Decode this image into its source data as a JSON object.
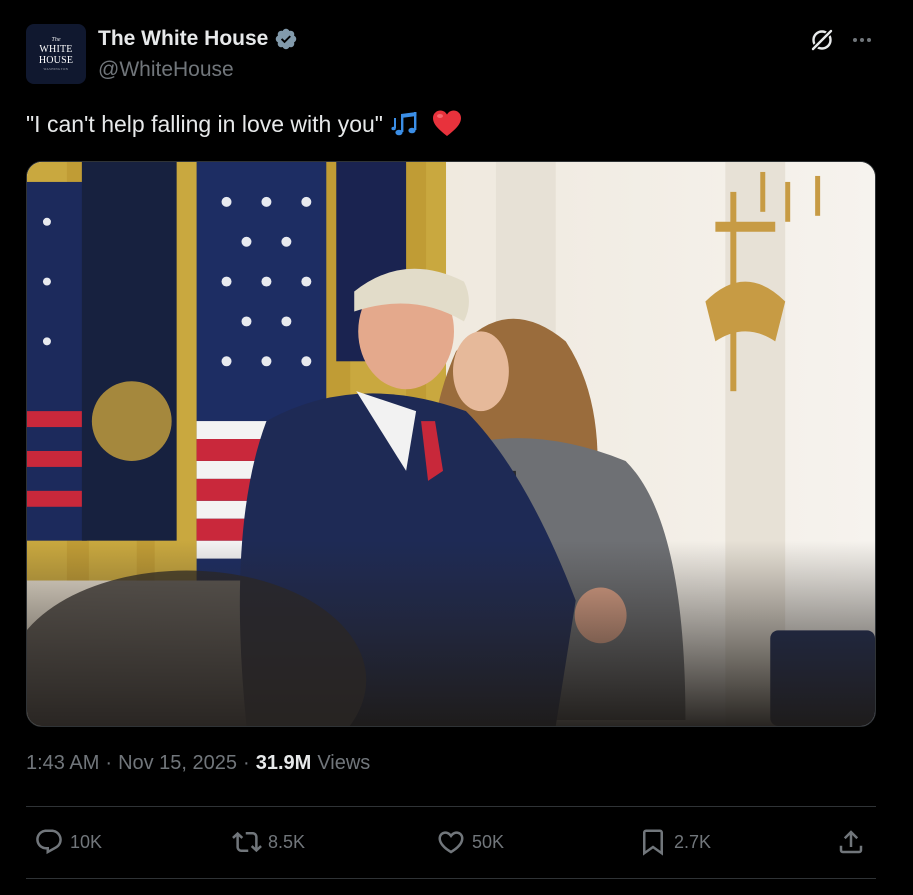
{
  "header": {
    "avatar": {
      "line_small": "The",
      "line1": "WHITE",
      "line2": "HOUSE",
      "line_tiny": "WASHINGTON"
    },
    "display_name": "The White House",
    "handle": "@WhiteHouse",
    "verified_icon": "verified-badge-icon",
    "grok_icon": "grok-icon",
    "more_icon": "more-icon"
  },
  "tweet": {
    "text": "\"I can't help falling in love with you\"",
    "emojis": [
      "musical-notes-icon",
      "red-heart-icon"
    ]
  },
  "meta": {
    "time": "1:43 AM",
    "separator": "·",
    "date": "Nov 15, 2025",
    "views_count": "31.9M",
    "views_label": "Views"
  },
  "actions": {
    "reply_count": "10K",
    "retweet_count": "8.5K",
    "like_count": "50K",
    "bookmark_count": "2.7K"
  },
  "colors": {
    "background": "#000000",
    "primary_text": "#e7e9ea",
    "secondary_text": "#71767b",
    "divider": "#2f3336",
    "verified_badge": "#829aab",
    "notes_blue": "#3b8ee6",
    "heart_red": "#e8323c"
  }
}
